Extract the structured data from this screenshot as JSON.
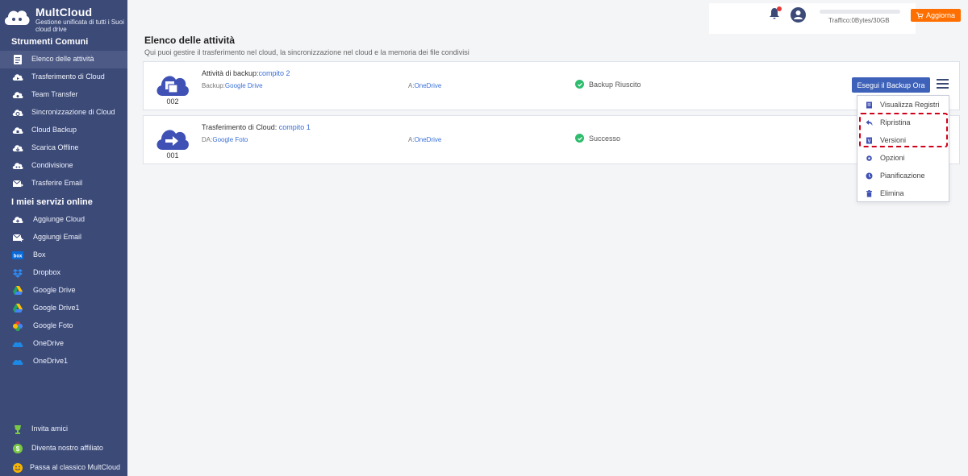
{
  "brand": {
    "name": "MultCloud",
    "tagline": "Gestione unificata di tutti i Suoi cloud drive"
  },
  "sidebar": {
    "section1_title": "Strumenti Comuni",
    "tools": [
      {
        "label": "Elenco delle attività",
        "icon": "task-list-icon",
        "active": true
      },
      {
        "label": "Trasferimento di Cloud",
        "icon": "cloud-transfer-icon"
      },
      {
        "label": "Team Transfer",
        "icon": "team-transfer-icon"
      },
      {
        "label": "Sincronizzazione di Cloud",
        "icon": "cloud-sync-icon"
      },
      {
        "label": "Cloud Backup",
        "icon": "cloud-backup-icon"
      },
      {
        "label": "Scarica Offline",
        "icon": "offline-download-icon"
      },
      {
        "label": "Condivisione",
        "icon": "share-icon"
      },
      {
        "label": "Trasferire Email",
        "icon": "email-transfer-icon"
      }
    ],
    "section2_title": "I miei servizi online",
    "services": [
      {
        "label": "Aggiunge Cloud",
        "icon": "add-cloud-icon"
      },
      {
        "label": "Aggiungi Email",
        "icon": "add-email-icon"
      },
      {
        "label": "Box",
        "icon": "box-icon"
      },
      {
        "label": "Dropbox",
        "icon": "dropbox-icon"
      },
      {
        "label": "Google Drive",
        "icon": "google-drive-icon"
      },
      {
        "label": "Google Drive1",
        "icon": "google-drive-icon"
      },
      {
        "label": "Google Foto",
        "icon": "google-photos-icon"
      },
      {
        "label": "OneDrive",
        "icon": "onedrive-icon"
      },
      {
        "label": "OneDrive1",
        "icon": "onedrive-icon"
      }
    ],
    "footer": [
      {
        "label": "Invita amici",
        "icon": "trophy-icon"
      },
      {
        "label": "Diventa nostro affiliato",
        "icon": "dollar-icon"
      },
      {
        "label": "Passa al classico MultCloud",
        "icon": "smile-icon"
      }
    ]
  },
  "header": {
    "traffic": "Traffico:0Bytes/30GB",
    "upgrade_label": "Aggiorna",
    "colors": {
      "upgrade": "#ff6f00",
      "sidebar": "#3c4a78",
      "primary_button": "#3e62b9"
    }
  },
  "main": {
    "title": "Elenco delle attività",
    "subtitle": "Qui puoi gestire il trasferimento nel cloud, la sincronizzazione nel cloud e la memoria dei file condivisi",
    "tasks": [
      {
        "type_label": "Attività di backup:",
        "name": "compito 2",
        "source_label": "Backup:",
        "source": "Google Drive",
        "dest_label": "A:",
        "dest": "OneDrive",
        "status": "Backup Riuscito",
        "number": "002",
        "action_label": "Esegui il Backup Ora"
      },
      {
        "type_label": "Trasferimento di Cloud:",
        "name": "compito 1",
        "source_label": "DA:",
        "source": "Google Foto",
        "dest_label": "A:",
        "dest": "OneDrive",
        "status": "Successo",
        "number": "001"
      }
    ],
    "menu": [
      {
        "label": "Visualizza Registri",
        "icon": "log-icon"
      },
      {
        "label": "Ripristina",
        "icon": "restore-icon"
      },
      {
        "label": "Versioni",
        "icon": "versions-icon"
      },
      {
        "label": "Opzioni",
        "icon": "gear-icon"
      },
      {
        "label": "Pianificazione",
        "icon": "clock-icon"
      },
      {
        "label": "Elimina",
        "icon": "trash-icon"
      }
    ]
  }
}
